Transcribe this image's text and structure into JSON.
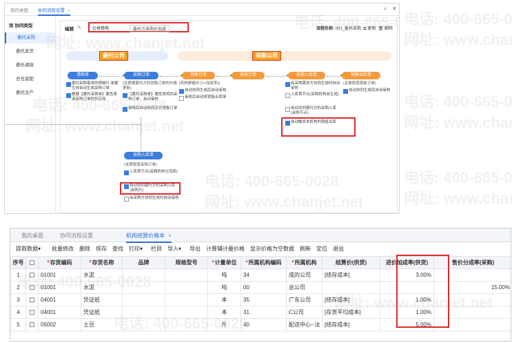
{
  "top": {
    "tabs": [
      {
        "label": "我的桌面"
      },
      {
        "label": "协同流程设置"
      }
    ],
    "sidebar": {
      "header": "协同类型",
      "items": [
        {
          "label": "委托采购"
        },
        {
          "label": "委托发货"
        },
        {
          "label": "委托调拨"
        },
        {
          "label": "总仓直配"
        },
        {
          "label": "委托生产"
        }
      ]
    },
    "edit_label": "编辑",
    "price_strategy": "价格策略",
    "rate_option": "委托方采购价加成",
    "flow_info_label": "流程名称:",
    "flow_info_value": "001_委托采购",
    "copy_label": "复制",
    "delete_label": "删除",
    "sales_company": "委托公司",
    "buy_company": "采购公司",
    "nodes": {
      "request": "请购单",
      "purchase_order_left": "采购订单",
      "sales_order": "销售订单",
      "purchase_order_right": "采购订单",
      "purchase_inbound": "采购入库单",
      "sales_outbound": "销售出库单",
      "purchase_inbound_lower": "采购入库单"
    },
    "notes": {
      "request_cb1": "委托采购需求的明细行,单据生效自动生成采购订单",
      "request_cb2": "根据【委托采购单】属性将请采购订单的供应商",
      "po_note": "(在根据委托方的销售订单的价格更新)",
      "po_cb1": "【委托采购单】属性将将的采购订单、自动审核",
      "po_cb2": "审核后自动协同对方销售订单",
      "so_note": "(机构屏蔽价:(1+加成率))",
      "so_cb1": "自动协同生成后自动审核",
      "so_cb2": "审核后自动将销售出库单",
      "pi_cb1": "由采购需求方协同生成时自动审核",
      "pi_cb2": "入库首节点(采购机构自生成)",
      "pi_cb3": "自动协同委托方的采购入库(采购节点)",
      "pi_cb4": "自动触发本机构的销售出库",
      "out_note": "(关联取值销售订单)",
      "out_cb1": "自动协同生成后自动审核",
      "low_note": "(关联取值采购订单)",
      "low_cb1": "入库首节点(采购机构分流库)",
      "low_cb2": "自动协同委托方的采购入库(采购方)",
      "low_cb3": "由采购方协同生成时自动审核"
    }
  },
  "bottom": {
    "tabs": [
      {
        "label": "我的桌面"
      },
      {
        "label": "协同流程设置"
      },
      {
        "label": "机构结算价格本"
      }
    ],
    "toolbar": [
      "提取数据▾",
      "批量修改",
      "删除",
      "保存",
      "查找",
      "打印▾",
      "栏目",
      "导入▾",
      "导出",
      "计算辅计量价格",
      "显示价格为空数据",
      "刷新",
      "定位",
      "退出"
    ],
    "columns": [
      "序号",
      "",
      "存货编码",
      "存货名称",
      "品牌",
      "规格型号",
      "计量单位",
      "所属机构编码",
      "所属机构",
      "结算价(供货)",
      "进价加成率(供货)",
      "售价分成率(采购)"
    ],
    "required_cols": [
      false,
      false,
      true,
      true,
      false,
      false,
      true,
      true,
      true,
      false,
      false,
      false
    ],
    "rows": [
      [
        "1",
        "",
        "01001",
        "水泥",
        "",
        "",
        "吨",
        "34",
        "成的公司",
        "[结存成本]",
        "3.00%",
        ""
      ],
      [
        "2",
        "",
        "01001",
        "水泥",
        "",
        "",
        "吨",
        "00",
        "总公司",
        "",
        "",
        "15.00%"
      ],
      [
        "3",
        "",
        "04001",
        "凭证纸",
        "",
        "",
        "本",
        "35",
        "广东公司",
        "[结存成本]",
        "1.00%",
        ""
      ],
      [
        "4",
        "",
        "04001",
        "凭证纸",
        "",
        "",
        "本",
        "31",
        "C公司",
        "[存货平均成本]",
        "1.00%",
        ""
      ],
      [
        "5",
        "",
        "05002",
        "土豆",
        "",
        "",
        "斤",
        "40",
        "配送中心--沈",
        "[结存成本]",
        "5.00%",
        ""
      ]
    ]
  },
  "watermark": {
    "phone": "电话: 400-665-0028",
    "site": "网址: www.chanjet.net"
  }
}
